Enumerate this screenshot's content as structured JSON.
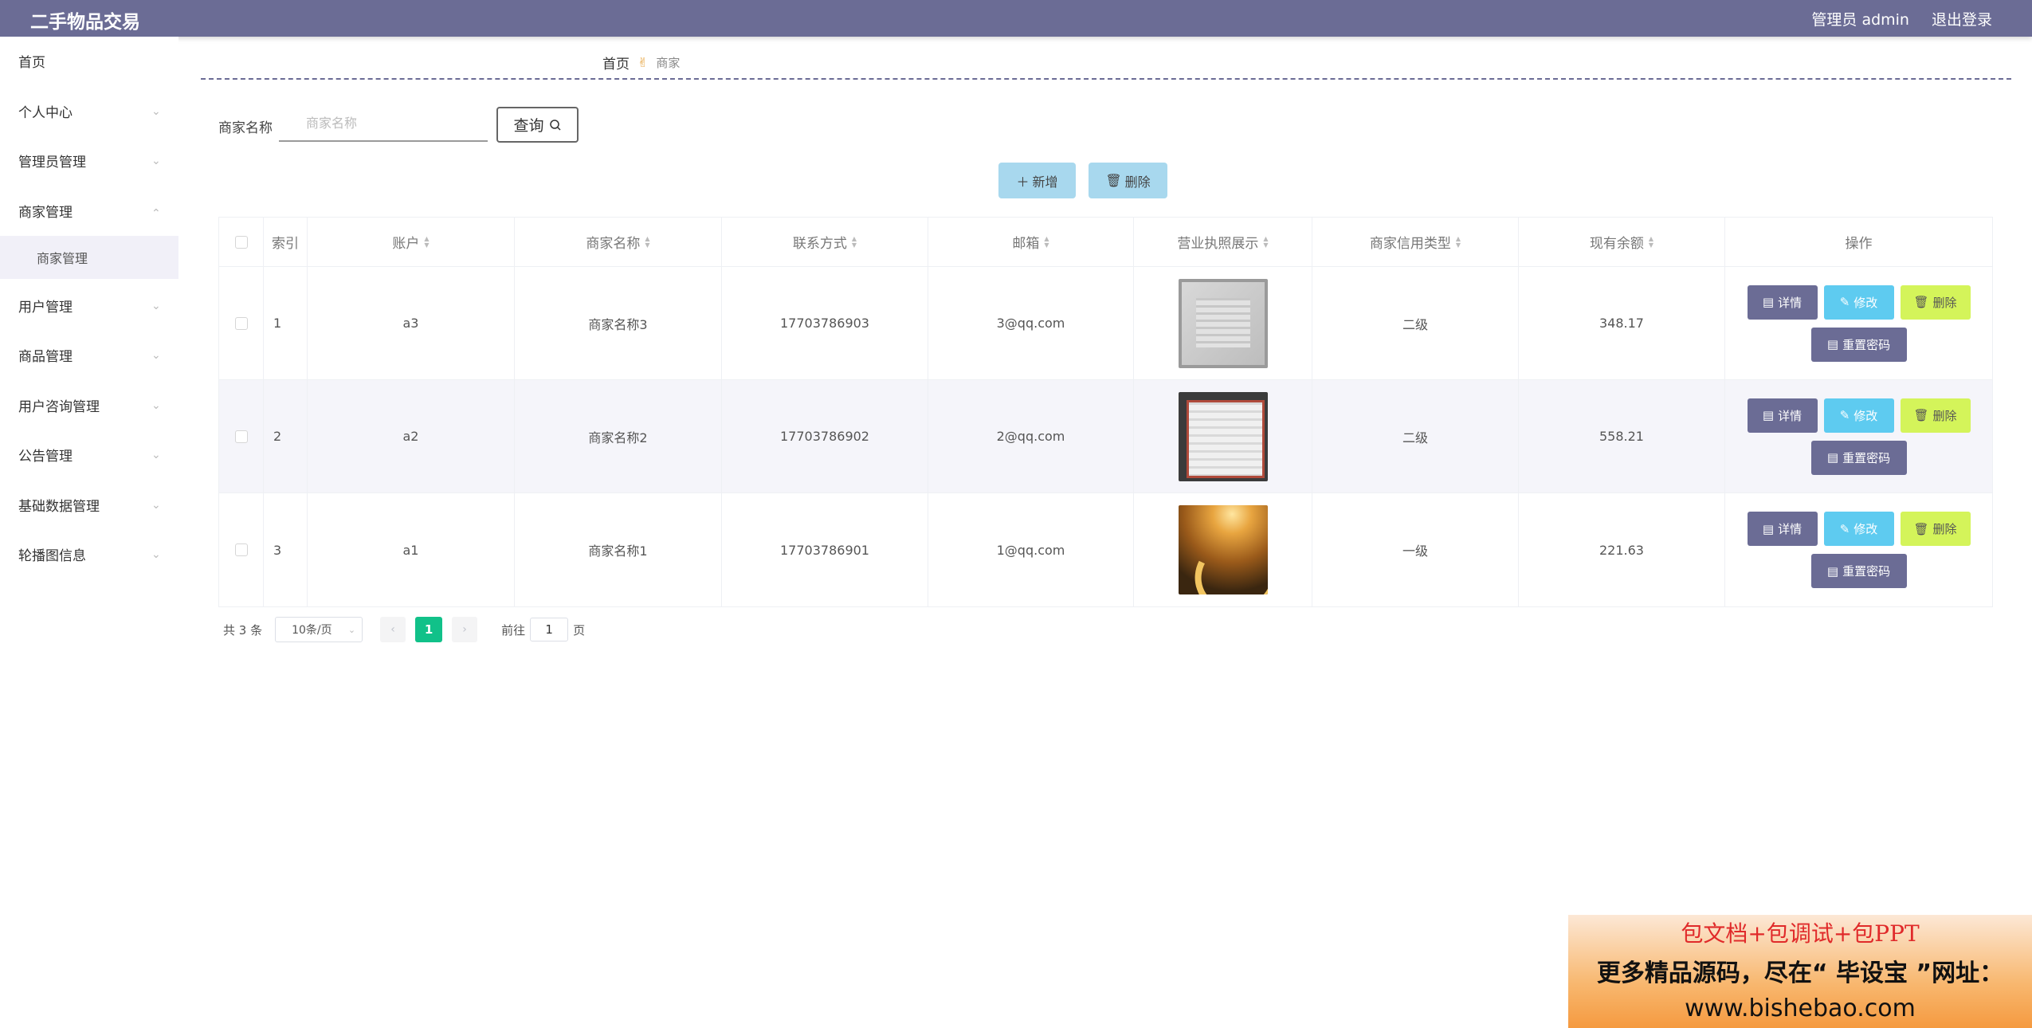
{
  "app": {
    "title": "二手物品交易"
  },
  "topbar": {
    "user_label": "管理员 admin",
    "logout_label": "退出登录"
  },
  "sidebar": {
    "items": [
      {
        "label": "首页"
      },
      {
        "label": "个人中心"
      },
      {
        "label": "管理员管理"
      },
      {
        "label": "商家管理"
      },
      {
        "label": "用户管理"
      },
      {
        "label": "商品管理"
      },
      {
        "label": "用户咨询管理"
      },
      {
        "label": "公告管理"
      },
      {
        "label": "基础数据管理"
      },
      {
        "label": "轮播图信息"
      }
    ],
    "sub_items": [
      {
        "label": "商家管理"
      }
    ]
  },
  "breadcrumb": {
    "home": "首页",
    "separator_icon": "hand-icon",
    "current": "商家"
  },
  "search": {
    "label": "商家名称",
    "placeholder": "商家名称",
    "value": "",
    "button_label": "查询"
  },
  "actions": {
    "add_label": "新增",
    "delete_label": "删除"
  },
  "table": {
    "headers": {
      "index": "索引",
      "account": "账户",
      "name": "商家名称",
      "phone": "联系方式",
      "email": "邮箱",
      "license": "营业执照展示",
      "credit": "商家信用类型",
      "balance": "现有余额",
      "ops": "操作"
    },
    "rows": [
      {
        "index": "1",
        "account": "a3",
        "name": "商家名称3",
        "phone": "17703786903",
        "email": "3@qq.com",
        "credit": "二级",
        "balance": "348.17"
      },
      {
        "index": "2",
        "account": "a2",
        "name": "商家名称2",
        "phone": "17703786902",
        "email": "2@qq.com",
        "credit": "二级",
        "balance": "558.21"
      },
      {
        "index": "3",
        "account": "a1",
        "name": "商家名称1",
        "phone": "17703786901",
        "email": "1@qq.com",
        "credit": "一级",
        "balance": "221.63"
      }
    ],
    "op_labels": {
      "detail": "详情",
      "edit": "修改",
      "delete": "删除",
      "reset": "重置密码"
    }
  },
  "pagination": {
    "total": "共 3 条",
    "page_size": "10条/页",
    "current_page": "1",
    "goto_label": "前往",
    "goto_value": "1",
    "page_suffix": "页"
  },
  "promo": {
    "line1": "包文档+包调试+包PPT",
    "line2": "更多精品源码，尽在“ 毕设宝 ”网址：",
    "line3": "www.bishebao.com"
  },
  "colors": {
    "topbar": "#6b6c95",
    "accent_green": "#11c189",
    "edit_blue": "#5ecbf0",
    "delete_lime": "#d4f45a",
    "action_light_blue": "#a8d8ee"
  }
}
